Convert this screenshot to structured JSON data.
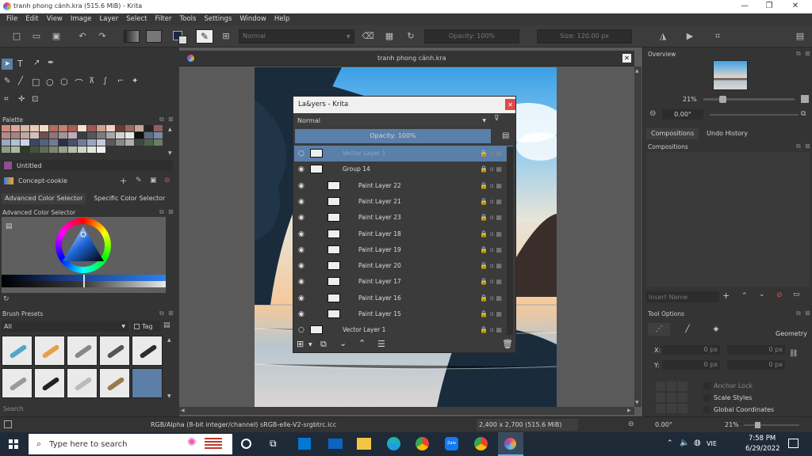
{
  "window": {
    "title": "tranh phong cảnh.kra (515.6 MiB)  - Krita"
  },
  "menu": [
    "File",
    "Edit",
    "View",
    "Image",
    "Layer",
    "Select",
    "Filter",
    "Tools",
    "Settings",
    "Window",
    "Help"
  ],
  "toolbar": {
    "blend_mode": "Normal",
    "opacity": "Opacity: 100%",
    "size": "Size: 120.00 px"
  },
  "left": {
    "palette_title": "Palette",
    "palette_name": "Untitled",
    "resource_name": "Concept-cookie",
    "color_tabs": [
      "Advanced Color Selector",
      "Specific Color Selector"
    ],
    "color_panel_title": "Advanced Color Selector",
    "brush_title": "Brush Presets",
    "brush_filter": "All",
    "brush_tag": "Tag",
    "brush_search": "Search"
  },
  "canvas": {
    "tab_title": "tranh phong cảnh.kra"
  },
  "layers_dialog": {
    "title": "La&yers - Krita",
    "blend_mode": "Normal",
    "opacity": "Opacity:  100%",
    "layers": [
      {
        "name": "Vector Layer 1",
        "selected": true,
        "indent": 0
      },
      {
        "name": "Group 14",
        "selected": false,
        "indent": 0
      },
      {
        "name": "Paint Layer 22",
        "selected": false,
        "indent": 1
      },
      {
        "name": "Paint Layer 21",
        "selected": false,
        "indent": 1
      },
      {
        "name": "Paint Layer 23",
        "selected": false,
        "indent": 1
      },
      {
        "name": "Paint Layer 18",
        "selected": false,
        "indent": 1
      },
      {
        "name": "Paint Layer 19",
        "selected": false,
        "indent": 1
      },
      {
        "name": "Paint Layer 20",
        "selected": false,
        "indent": 1
      },
      {
        "name": "Paint Layer 17",
        "selected": false,
        "indent": 1
      },
      {
        "name": "Paint Layer 16",
        "selected": false,
        "indent": 1
      },
      {
        "name": "Paint Layer 15",
        "selected": false,
        "indent": 1
      },
      {
        "name": "Vector Layer 1",
        "selected": false,
        "indent": 0
      }
    ]
  },
  "right": {
    "overview_title": "Overview",
    "zoom": "21%",
    "rotation": "0.00°",
    "tabs": [
      "Compositions",
      "Undo History"
    ],
    "compositions_title": "Compositions",
    "insert_name_placeholder": "Insert Name",
    "tool_options_title": "Tool Options",
    "geometry_label": "Geometry",
    "x_label": "X:",
    "y_label": "Y:",
    "x_val": "0 px",
    "y_val": "0 px",
    "w_val": "0 px",
    "h_val": "0 px",
    "anchor_lock": "Anchor Lock",
    "scale_styles": "Scale Styles",
    "global_coordinates": "Global Coordinates"
  },
  "status": {
    "color_info": "RGB/Alpha (8-bit integer/channel)  sRGB-elle-V2-srgbtrc.icc",
    "dims": "2,400 x 2,700 (515.6 MiB)",
    "rotation": "0.00°",
    "zoom": "21%"
  },
  "taskbar": {
    "search_placeholder": "Type here to search",
    "time": "7:58 PM",
    "date": "6/29/2022",
    "lang": "VIE"
  },
  "colors": {
    "accent": "#5b7fa6",
    "selected_layer": "#5a7fa8"
  }
}
